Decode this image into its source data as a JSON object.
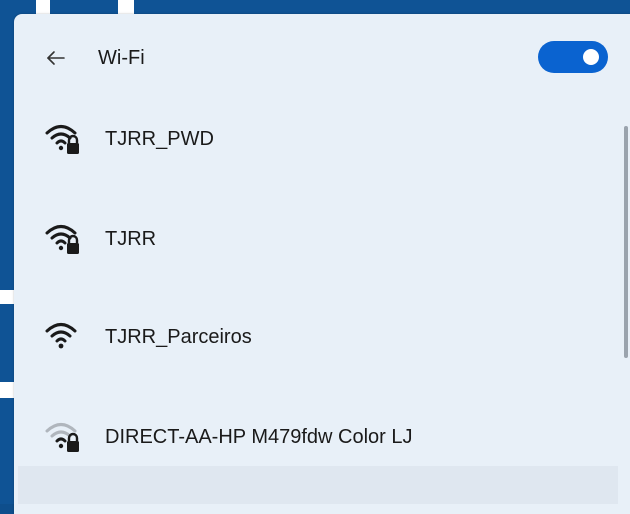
{
  "header": {
    "back_icon": "arrow-left-icon",
    "title": "Wi-Fi",
    "toggle_state": "on"
  },
  "networks": [
    {
      "name": "TJRR_PWD",
      "icon": "wifi-secured-icon",
      "secured": true,
      "signal": "strong"
    },
    {
      "name": "TJRR",
      "icon": "wifi-secured-icon",
      "secured": true,
      "signal": "strong"
    },
    {
      "name": "TJRR_Parceiros",
      "icon": "wifi-icon",
      "secured": false,
      "signal": "strong"
    },
    {
      "name": "DIRECT-AA-HP M479fdw Color LJ",
      "icon": "wifi-secured-icon",
      "secured": true,
      "signal": "weak"
    }
  ],
  "colors": {
    "accent": "#0a63d0",
    "panel_background": "#e8f0f8",
    "text": "#1a1a1a",
    "desktop": "#0f5395"
  }
}
